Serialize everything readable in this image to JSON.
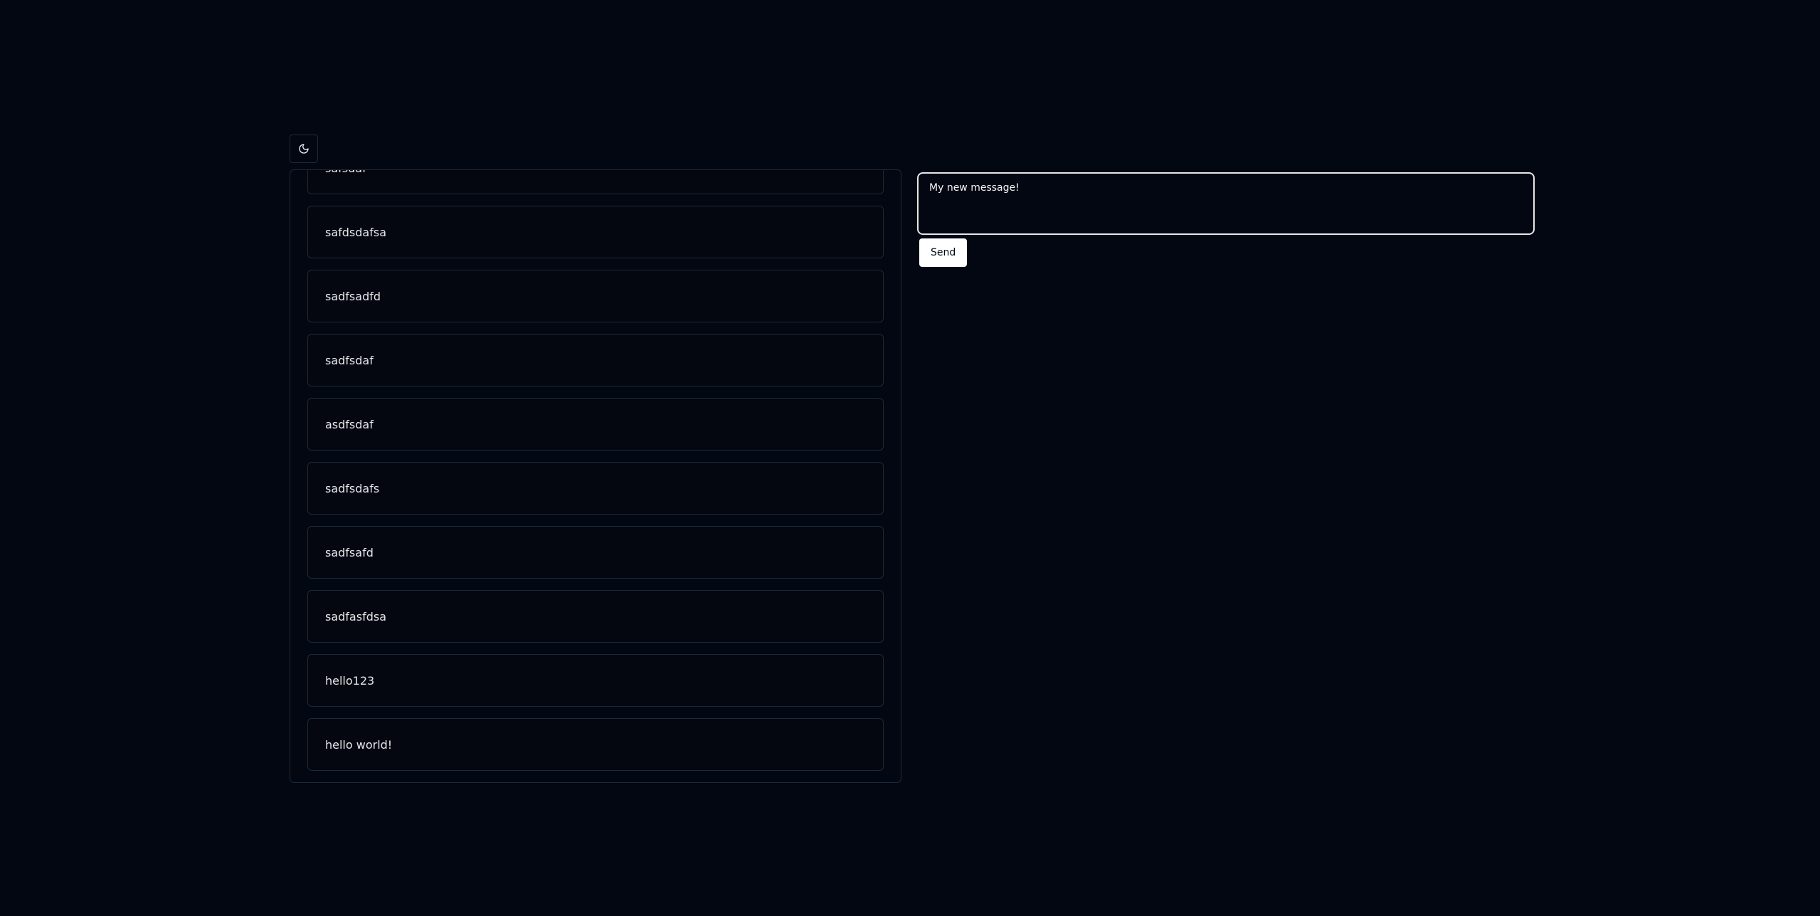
{
  "theme_toggle": {
    "icon": "moon-icon"
  },
  "messages": [
    "safsdaf",
    "safdsdafsa",
    "sadfsadfd",
    "sadfsdaf",
    "asdfsdaf",
    "sadfsdafs",
    "sadfsafd",
    "sadfasfdsa",
    "hello123",
    "hello world!"
  ],
  "composer": {
    "input_value": "My new message!",
    "send_label": "Send"
  }
}
